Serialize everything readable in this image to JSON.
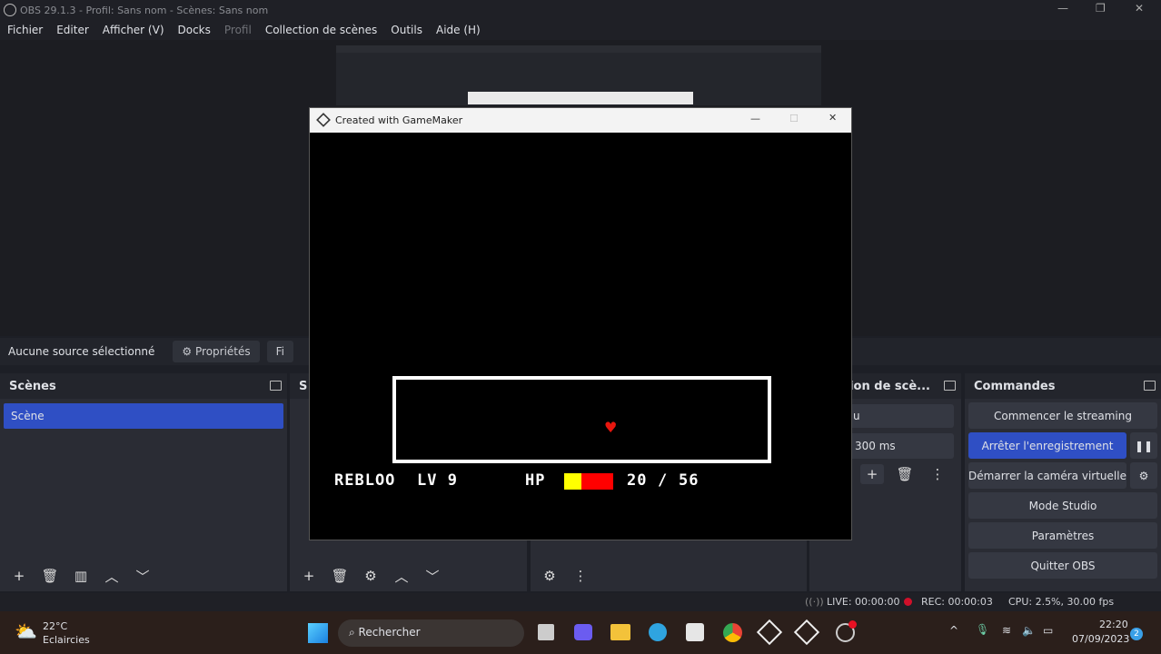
{
  "window": {
    "title": "OBS 29.1.3 - Profil: Sans nom - Scènes: Sans nom"
  },
  "menu": [
    "Fichier",
    "Editer",
    "Afficher (V)",
    "Docks",
    "Profil",
    "Collection de scènes",
    "Outils",
    "Aide (H)"
  ],
  "source_bar": {
    "no_source": "Aucune source sélectionné",
    "properties": "Propriétés",
    "filters": "Fi"
  },
  "scenes": {
    "title": "Scènes",
    "items": [
      "Scène"
    ]
  },
  "sources": {
    "title": "S"
  },
  "transitions": {
    "title": "ition de scè...",
    "type": "u",
    "duration": "300 ms"
  },
  "controls": {
    "title": "Commandes",
    "start_streaming": "Commencer le streaming",
    "stop_recording": "Arrêter l'enregistrement",
    "virtual_cam": "Démarrer la caméra virtuelle",
    "studio_mode": "Mode Studio",
    "settings": "Paramètres",
    "exit": "Quitter OBS"
  },
  "status": {
    "live": "LIVE: 00:00:00",
    "rec": "REC: 00:00:03",
    "cpu": "CPU: 2.5%, 30.00 fps"
  },
  "game": {
    "title": "Created with GameMaker",
    "name": "REBLOO",
    "lv": "LV 9",
    "hp_label": "HP",
    "hp_current": "20",
    "hp_sep": "/",
    "hp_max": "56",
    "hp_fraction": 0.357,
    "hp_color": "#ffff00",
    "hp_lost_color": "#ff0000"
  },
  "taskbar": {
    "temp": "22°C",
    "weather": "Eclaircies",
    "search": "Rechercher",
    "time": "22:20",
    "date": "07/09/2023",
    "notif": "2"
  },
  "colors": {
    "accent": "#2f4fc4",
    "rec": "#d0102a"
  }
}
